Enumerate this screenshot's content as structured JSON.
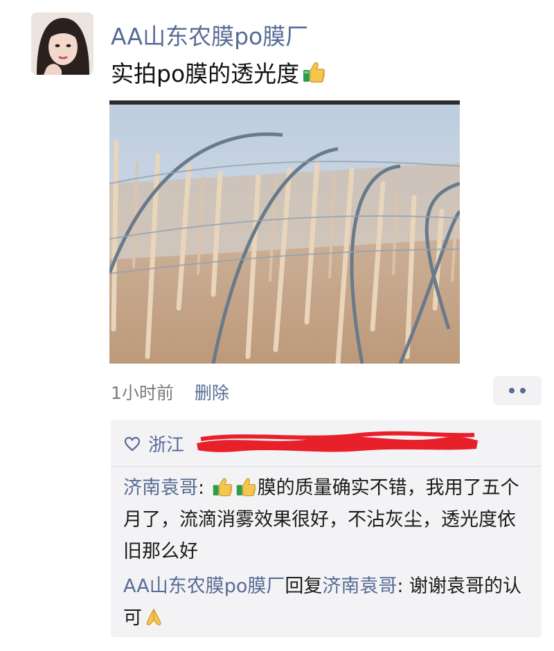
{
  "post": {
    "author": "AA山东农膜po膜厂",
    "caption": "实拍po膜的透光度",
    "caption_emoji": "thumbs-up-emoji",
    "time": "1小时前",
    "delete_label": "删除"
  },
  "likes": {
    "text": "浙江"
  },
  "comments": [
    {
      "author": "济南袁哥",
      "separator": ": ",
      "text": "膜的质量确实不错，我用了五个月了，流滴消雾效果很好，不沾灰尘，透光度依旧那么好"
    },
    {
      "author": "AA山东农膜po膜厂",
      "reply_word": "回复",
      "reply_to": "济南袁哥",
      "separator": ": ",
      "text": "谢谢袁哥的认可"
    }
  ],
  "colors": {
    "name_blue": "#576b95",
    "comment_bg": "#f3f3f5",
    "redaction_red": "#e8202a"
  }
}
